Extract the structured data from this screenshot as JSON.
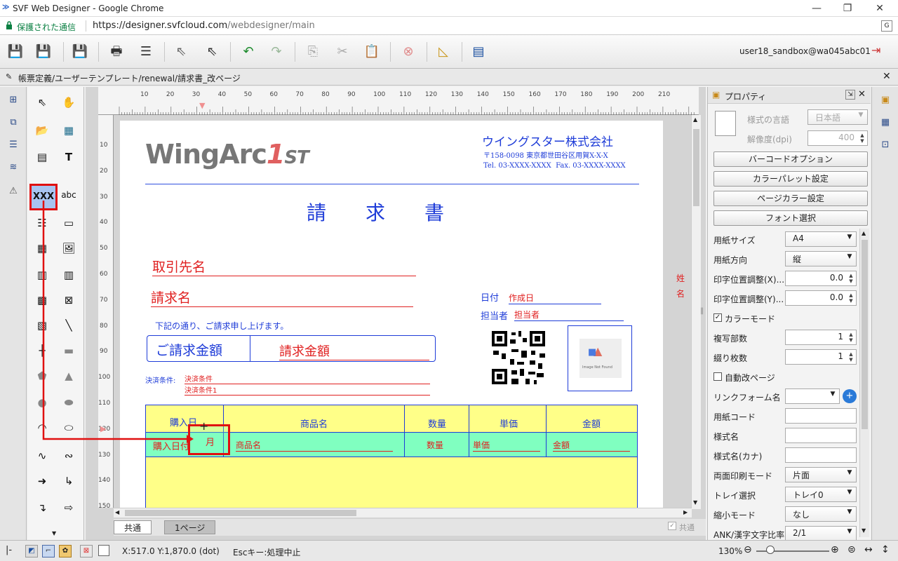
{
  "window": {
    "title": "SVF Web Designer - Google Chrome"
  },
  "address": {
    "secure_label": "保護された通信",
    "url_host": "https://designer.svfcloud.com",
    "url_path": "/webdesigner/main"
  },
  "toolbar": {
    "user": "user18_sandbox@wa045abc01"
  },
  "path": "帳票定義/ユーザーテンプレート/renewal/請求書_改ページ",
  "palette": {
    "text_field": "XXX",
    "label": "abc",
    "t_tool": "T"
  },
  "ruler": {
    "top": [
      "10",
      "20",
      "30",
      "40",
      "50",
      "60",
      "70",
      "80",
      "90",
      "100",
      "110",
      "120",
      "130",
      "140",
      "150",
      "160",
      "170",
      "180",
      "190",
      "200",
      "210"
    ],
    "left": [
      "10",
      "20",
      "30",
      "40",
      "50",
      "60",
      "70",
      "80",
      "90",
      "100",
      "110",
      "120",
      "130",
      "140",
      "150"
    ]
  },
  "paper": {
    "logo_main": "WingArc",
    "logo_num": "1",
    "logo_st": "ST",
    "company": "ウイングスター株式会社",
    "address": "〒158-0098 東京都世田谷区用賀X-X-X",
    "tel": "Tel. 03-XXXX-XXXX  Fax. 03-XXXX-XXXX",
    "title": "請　　求　　書",
    "client": "取引先名",
    "billing": "請求名",
    "date_label": "日付",
    "date_field": "作成日",
    "person_label": "担当者",
    "person_field": "担当者",
    "notice": "下記の通り、ご請求申し上げます。",
    "amount_label": "ご請求金額",
    "amount_field": "請求金額",
    "payment_label": "決済条件:",
    "payment1": "決済条件",
    "payment2": "決済条件1",
    "side1": "姓",
    "side2": "名",
    "image_text": "Image Not Found",
    "table": {
      "headers": [
        "購入日",
        "商品名",
        "数量",
        "単価",
        "金額"
      ],
      "row": [
        "購入日付",
        "商品名",
        "数量",
        "単価",
        "金額"
      ],
      "month": "月"
    }
  },
  "tabs": {
    "common": "共通",
    "page1": "1ページ",
    "check": "共通"
  },
  "props": {
    "title": "プロパティ",
    "lang_label": "様式の言語",
    "lang_value": "日本語",
    "dpi_label": "解像度(dpi)",
    "dpi_value": "400",
    "btn_barcode": "バーコードオプション",
    "btn_palette": "カラーパレット設定",
    "btn_pagecolor": "ページカラー設定",
    "btn_font": "フォント選択",
    "rows": [
      {
        "label": "用紙サイズ",
        "value": "A4",
        "kind": "drop"
      },
      {
        "label": "用紙方向",
        "value": "縦",
        "kind": "drop"
      },
      {
        "label": "印字位置調整(X)...",
        "value": "0.0",
        "kind": "spin"
      },
      {
        "label": "印字位置調整(Y)...",
        "value": "0.0",
        "kind": "spin"
      },
      {
        "label": "カラーモード",
        "value": "",
        "kind": "check"
      },
      {
        "label": "複写部数",
        "value": "1",
        "kind": "spin"
      },
      {
        "label": "綴り枚数",
        "value": "1",
        "kind": "spin"
      },
      {
        "label": "自動改ページ",
        "value": "",
        "kind": "uncheck"
      },
      {
        "label": "リンクフォーム名",
        "value": "",
        "kind": "link"
      },
      {
        "label": "用紙コード",
        "value": "",
        "kind": "field"
      },
      {
        "label": "様式名",
        "value": "",
        "kind": "field"
      },
      {
        "label": "様式名(カナ)",
        "value": "",
        "kind": "field"
      },
      {
        "label": "両面印刷モード",
        "value": "片面",
        "kind": "drop"
      },
      {
        "label": "トレイ選択",
        "value": "トレイ0",
        "kind": "drop"
      },
      {
        "label": "縮小モード",
        "value": "なし",
        "kind": "drop"
      },
      {
        "label": "ANK/漢字文字比率",
        "value": "2/1",
        "kind": "drop"
      }
    ]
  },
  "status": {
    "coords": "X:517.0 Y:1,870.0 (dot)",
    "hint": "Escキー:処理中止",
    "zoom": "130%"
  }
}
